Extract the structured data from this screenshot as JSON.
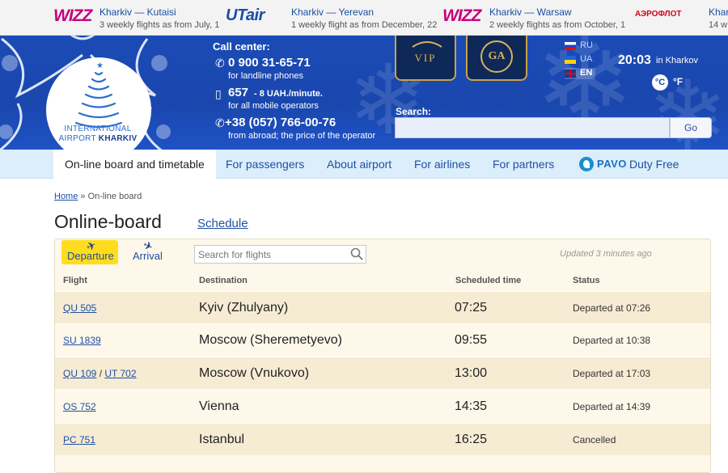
{
  "promo": [
    {
      "logo": "WIZZ",
      "route": "Kharkiv — Kutaisi",
      "note": "3 weekly flights as from July, 1"
    },
    {
      "logo": "UTair",
      "route": "Kharkiv — Yerevan",
      "note": "1 weekly flight as from December, 22"
    },
    {
      "logo": "WIZZ",
      "route": "Kharkiv — Warsaw",
      "note": "2 weekly flights as from October, 1"
    },
    {
      "logo": "АЭРОФЛОТ",
      "route": "Khar",
      "note": "14 w"
    }
  ],
  "logo": {
    "line1": "INTERNATIONAL",
    "line2_a": "AIRPORT ",
    "line2_b": "KHARKIV"
  },
  "call_center": {
    "title": "Call center:",
    "phone1": "0 900 31-65-71",
    "phone1_note": "for landline phones",
    "phone2": "657",
    "phone2_rate": "- 8 UAH./minute.",
    "phone2_note": "for all mobile operators",
    "phone3": "+38 (057) 766-00-76",
    "phone3_note": "from abroad; the price of the operator"
  },
  "badges": {
    "vip": "VIP",
    "ga": "GA"
  },
  "languages": [
    {
      "code": "RU"
    },
    {
      "code": "UA"
    },
    {
      "code": "EN"
    }
  ],
  "clock": {
    "time": "20:03",
    "city": "in Kharkov",
    "unit_c": "°C",
    "unit_f": "°F"
  },
  "search": {
    "label": "Search:",
    "go": "Go",
    "placeholder": ""
  },
  "nav": {
    "items": [
      {
        "label": "On-line board and timetable"
      },
      {
        "label": "For passengers"
      },
      {
        "label": "About airport"
      },
      {
        "label": "For airlines"
      },
      {
        "label": "For partners"
      }
    ],
    "pavo_logo": "PAVO",
    "duty_free": "Duty Free"
  },
  "breadcrumb": {
    "home": "Home",
    "separator": " » ",
    "current": "On-line board"
  },
  "page": {
    "title": "Online-board",
    "schedule_link": "Schedule"
  },
  "board": {
    "tabs": {
      "departure": "Departure",
      "arrival": "Arrival"
    },
    "search_placeholder": "Search for flights",
    "updated": "Updated 3 minutes ago",
    "columns": {
      "flight": "Flight",
      "destination": "Destination",
      "scheduled": "Scheduled time",
      "status": "Status"
    },
    "rows": [
      {
        "flight": "QU 505",
        "flight2": "",
        "destination": "Kyiv (Zhulyany)",
        "time": "07:25",
        "status": "Departed at 07:26"
      },
      {
        "flight": "SU 1839",
        "flight2": "",
        "destination": "Moscow (Sheremetyevo)",
        "time": "09:55",
        "status": "Departed at 10:38"
      },
      {
        "flight": "QU 109",
        "flight2": "UT 702",
        "destination": "Moscow (Vnukovo)",
        "time": "13:00",
        "status": "Departed at 17:03"
      },
      {
        "flight": "OS 752",
        "flight2": "",
        "destination": "Vienna",
        "time": "14:35",
        "status": "Departed at 14:39"
      },
      {
        "flight": "PC 751",
        "flight2": "",
        "destination": "Istanbul",
        "time": "16:25",
        "status": "Cancelled"
      }
    ]
  }
}
